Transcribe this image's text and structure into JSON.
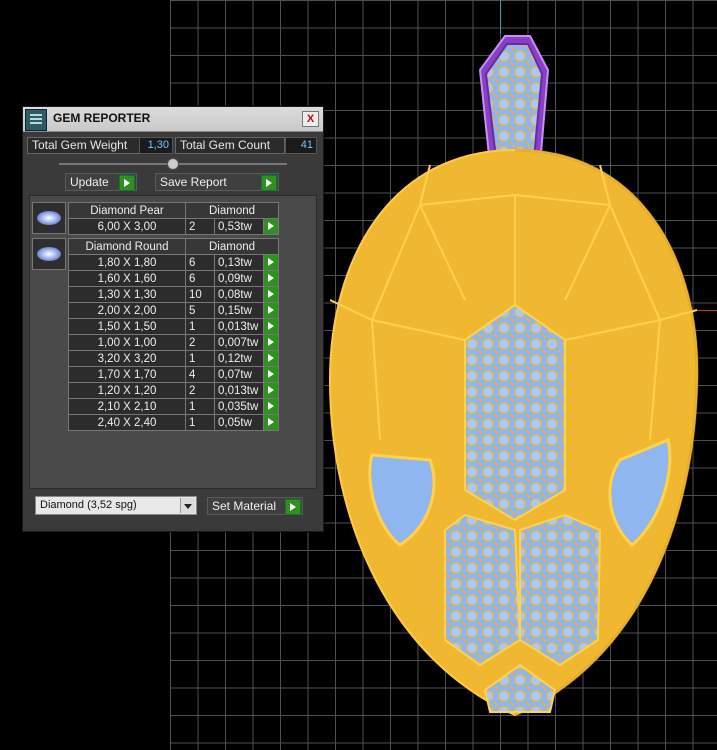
{
  "panel": {
    "title": "GEM REPORTER",
    "close_glyph": "X",
    "total_gem_weight_label": "Total Gem Weight",
    "total_gem_weight_value": "1,30",
    "total_gem_count_label": "Total Gem Count",
    "total_gem_count_value": "41",
    "update_label": "Update",
    "save_report_label": "Save Report",
    "groups": [
      {
        "shape": "Diamond Pear",
        "material": "Diamond",
        "rows": [
          {
            "size": "6,00 X 3,00",
            "count": "2",
            "weight": "0,53tw"
          }
        ]
      },
      {
        "shape": "Diamond Round",
        "material": "Diamond",
        "rows": [
          {
            "size": "1,80 X 1,80",
            "count": "6",
            "weight": "0,13tw"
          },
          {
            "size": "1,60 X 1,60",
            "count": "6",
            "weight": "0,09tw"
          },
          {
            "size": "1,30 X 1,30",
            "count": "10",
            "weight": "0,08tw"
          },
          {
            "size": "2,00 X 2,00",
            "count": "5",
            "weight": "0,15tw"
          },
          {
            "size": "1,50 X 1,50",
            "count": "1",
            "weight": "0,013tw"
          },
          {
            "size": "1,00 X 1,00",
            "count": "2",
            "weight": "0,007tw"
          },
          {
            "size": "3,20 X 3,20",
            "count": "1",
            "weight": "0,12tw"
          },
          {
            "size": "1,70 X 1,70",
            "count": "4",
            "weight": "0,07tw"
          },
          {
            "size": "1,20 X 1,20",
            "count": "2",
            "weight": "0,013tw"
          },
          {
            "size": "2,10 X 2,10",
            "count": "1",
            "weight": "0,035tw"
          },
          {
            "size": "2,40 X 2,40",
            "count": "1",
            "weight": "0,05tw"
          }
        ]
      }
    ],
    "material_select_value": "Diamond      (3,52 spg)",
    "set_material_label": "Set Material"
  },
  "icons": {
    "title_icon": "gem-reporter-icon",
    "close_icon": "close-icon",
    "go_icon": "green-play-arrow-icon",
    "thumb_icon": "gem-thumbnail-icon",
    "dropdown_icon": "chevron-down-icon"
  },
  "colors": {
    "viewport_bg": "#000000",
    "grid": "#555555",
    "gold": "#f0b830",
    "gem_blue": "#8ab4f0",
    "bail_purple": "#8a3fc8",
    "value_blue": "#6fc8ff",
    "go_green": "#2f8f1f"
  }
}
